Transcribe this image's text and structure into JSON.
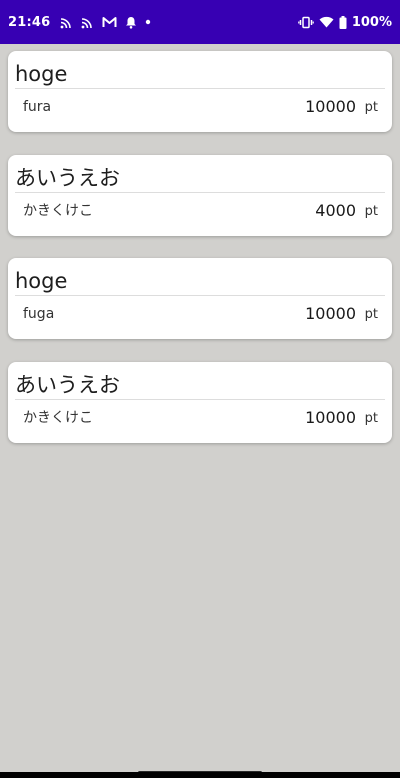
{
  "status_bar": {
    "time": "21:46",
    "battery_text": "100%",
    "background": "#3700b3",
    "left_icons": [
      "cast-icon",
      "cast-icon",
      "gmail-icon",
      "notification-bell-icon",
      "dot-icon"
    ],
    "right_icons": [
      "vibrate-icon",
      "wifi-icon",
      "battery-icon"
    ]
  },
  "cards": [
    {
      "title": "hoge",
      "subtitle": "fura",
      "points": "10000",
      "unit": "pt"
    },
    {
      "title": "あいうえお",
      "subtitle": "かきくけこ",
      "points": "4000",
      "unit": "pt"
    },
    {
      "title": "hoge",
      "subtitle": "fuga",
      "points": "10000",
      "unit": "pt"
    },
    {
      "title": "あいうえお",
      "subtitle": "かきくけこ",
      "points": "10000",
      "unit": "pt"
    }
  ]
}
